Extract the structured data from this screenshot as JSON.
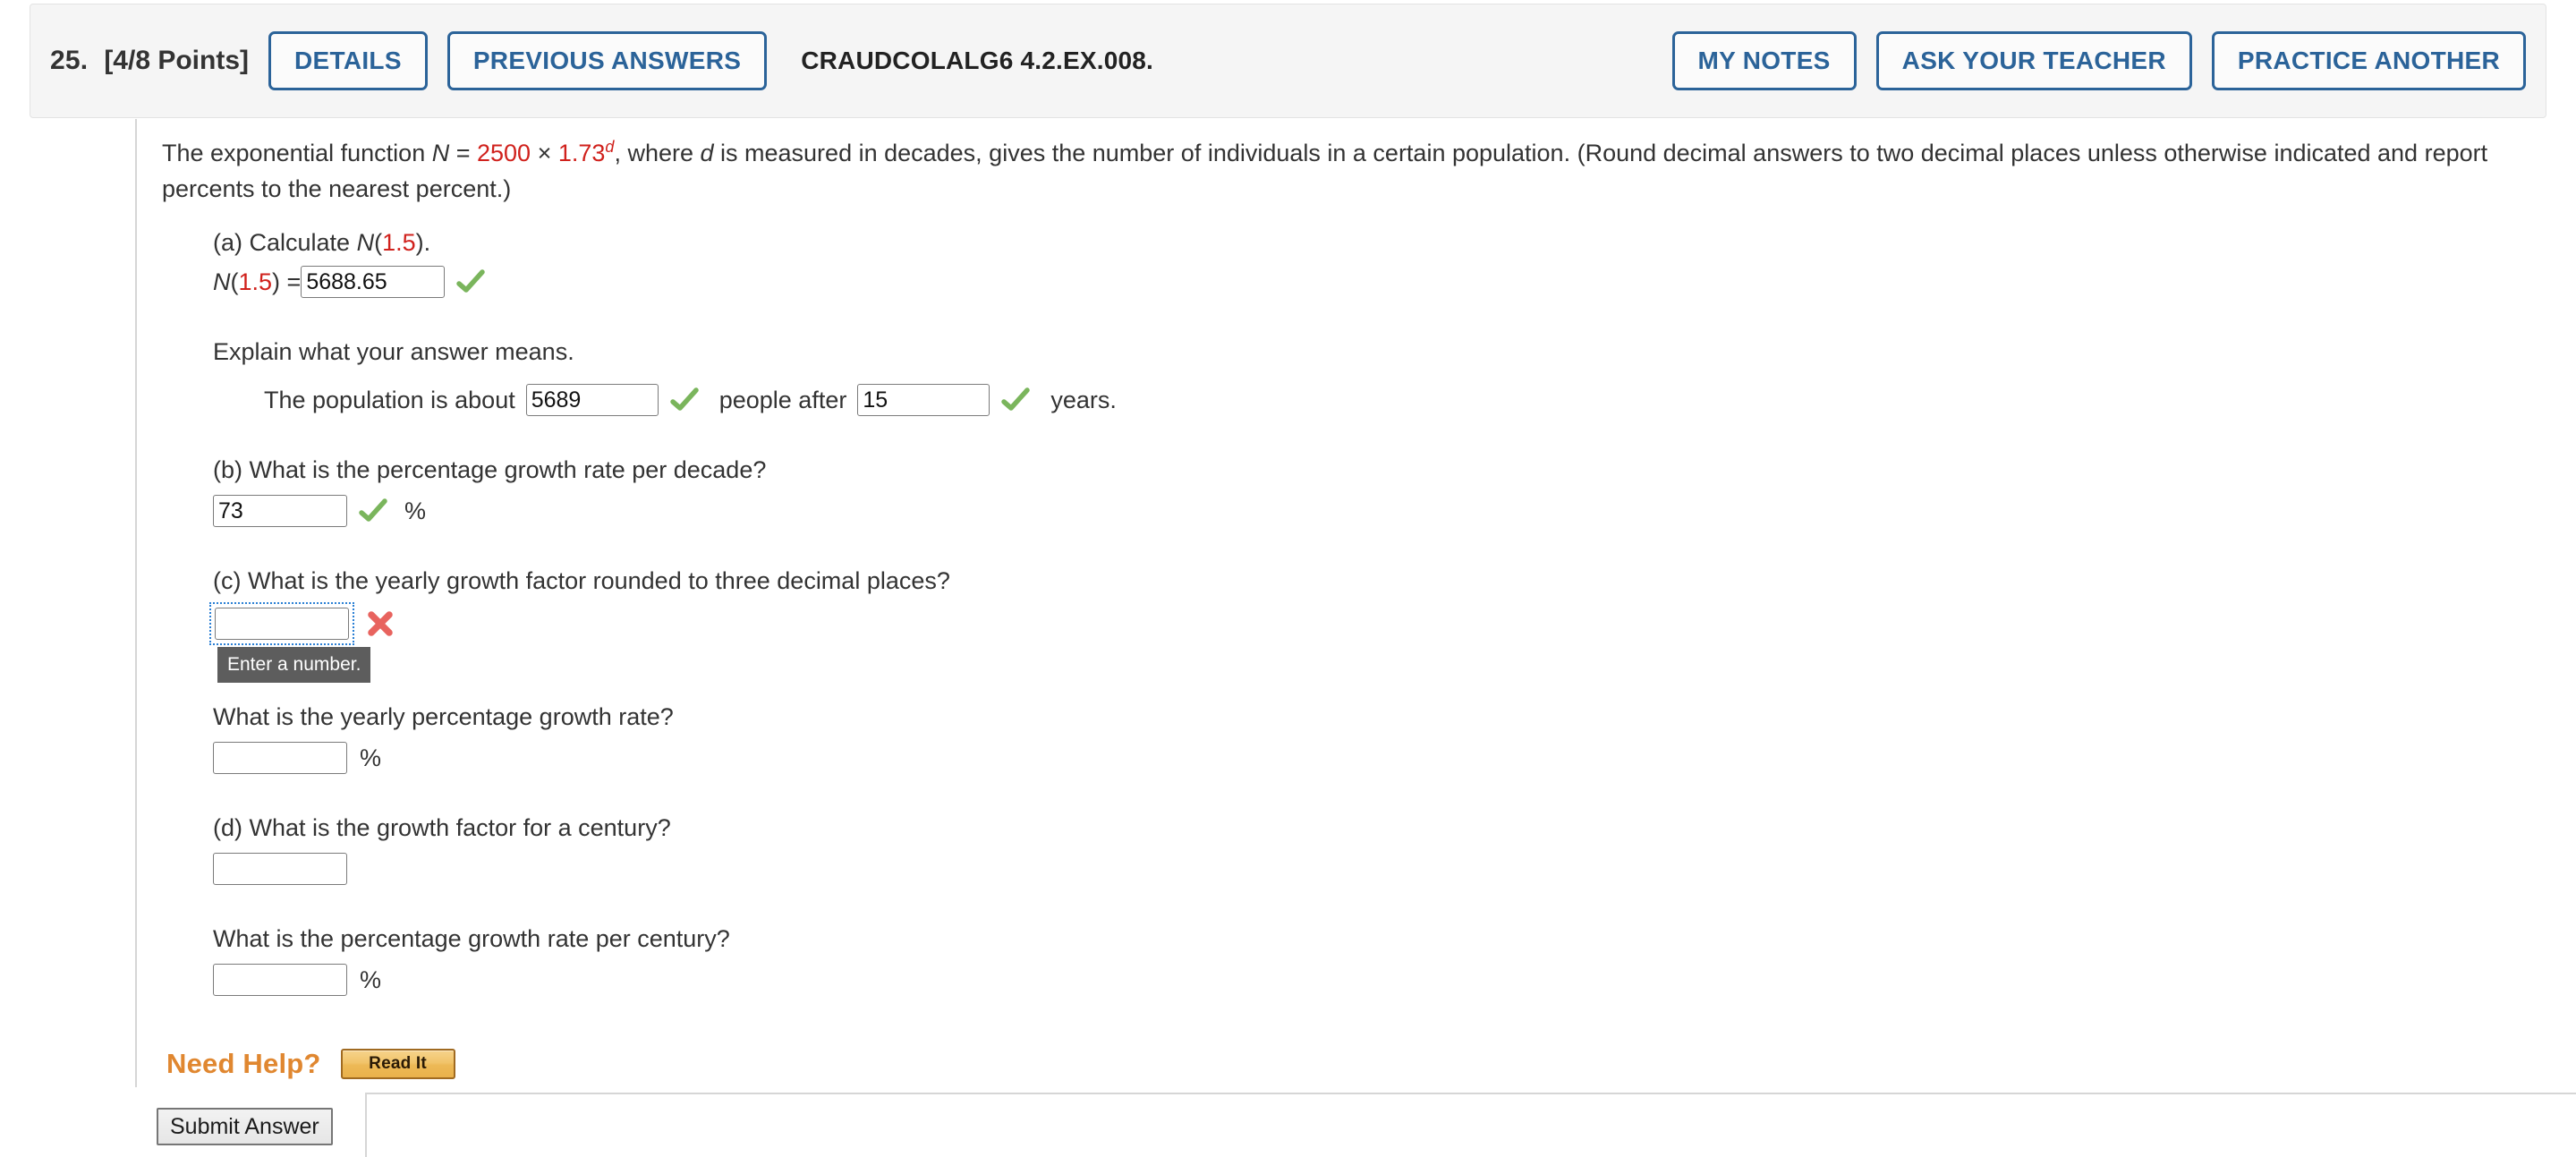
{
  "header": {
    "question_number": "25.",
    "points": "[4/8 Points]",
    "details_label": "DETAILS",
    "previous_answers_label": "PREVIOUS ANSWERS",
    "exercise_code": "CRAUDCOLALG6 4.2.EX.008.",
    "my_notes_label": "MY NOTES",
    "ask_your_teacher_label": "ASK YOUR TEACHER",
    "practice_another_label": "PRACTICE ANOTHER",
    "accent_color": "#2b6399",
    "panel_bg": "#f5f5f5"
  },
  "stem": {
    "t1": "The exponential function ",
    "var_N": "N",
    "t2": " = ",
    "coefficient": "2500",
    "t3": " × ",
    "base": "1.73",
    "exponent": "d",
    "t4": ", where ",
    "var_d": "d",
    "t5": " is measured in decades, gives the number of individuals in a certain population. (Round decimal answers to two decimal places unless otherwise indicated and report percents to the nearest percent.)",
    "highlight_color": "#d0211c"
  },
  "part_a": {
    "prompt_prefix": "(a) Calculate ",
    "prompt_fn": "N",
    "prompt_open": "(",
    "prompt_arg": "1.5",
    "prompt_close": ").",
    "eq_fn": "N",
    "eq_open": "(",
    "eq_arg": "1.5",
    "eq_close": ") = ",
    "answer_value": "5688.65",
    "status": "correct",
    "explain_prompt": "Explain what your answer means.",
    "sentence_part1": "The population is about",
    "population_value": "5689",
    "population_status": "correct",
    "sentence_part2": "people after",
    "years_value": "15",
    "years_status": "correct",
    "sentence_part3": "years."
  },
  "part_b": {
    "prompt": "(b) What is the percentage growth rate per decade?",
    "answer_value": "73",
    "status": "correct",
    "unit": "%"
  },
  "part_c": {
    "prompt": "(c) What is the yearly growth factor rounded to three decimal places?",
    "answer_value": "",
    "status": "incorrect",
    "tooltip": "Enter a number.",
    "focused": true,
    "subprompt": "What is the yearly percentage growth rate?",
    "sub_answer_value": "",
    "sub_unit": "%"
  },
  "part_d": {
    "prompt": "(d) What is the growth factor for a century?",
    "answer_value": "",
    "subprompt": "What is the percentage growth rate per century?",
    "sub_answer_value": "",
    "sub_unit": "%"
  },
  "need_help": {
    "label": "Need Help?",
    "read_it_label": "Read It",
    "label_color": "#e08730"
  },
  "footer": {
    "submit_label": "Submit Answer"
  }
}
